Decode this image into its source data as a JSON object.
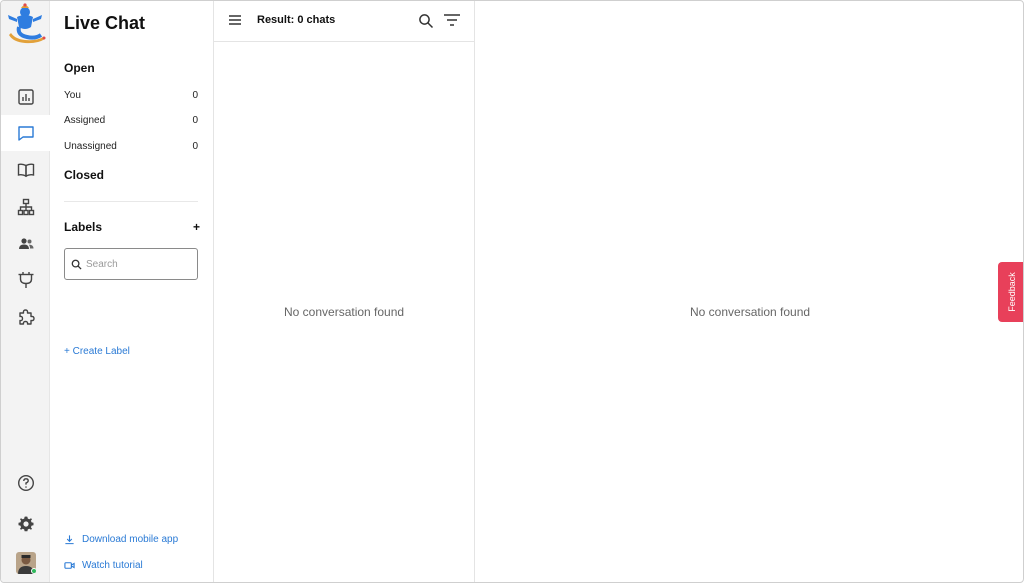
{
  "app": {
    "title": "Live Chat",
    "accent_color": "#2a7ad5",
    "feedback_color": "#e8405a"
  },
  "rail": {
    "items": [
      {
        "icon": "analytics-icon",
        "active": false
      },
      {
        "icon": "chat-bubble-icon",
        "active": true
      },
      {
        "icon": "book-icon",
        "active": false
      },
      {
        "icon": "sitemap-icon",
        "active": false
      },
      {
        "icon": "contacts-icon",
        "active": false
      },
      {
        "icon": "plug-icon",
        "active": false
      },
      {
        "icon": "puzzle-icon",
        "active": false
      }
    ],
    "bottom": [
      {
        "icon": "help-circle-icon"
      },
      {
        "icon": "gear-icon"
      }
    ]
  },
  "sidebar": {
    "open_heading": "Open",
    "open_items": [
      {
        "label": "You",
        "count": "0"
      },
      {
        "label": "Assigned",
        "count": "0"
      },
      {
        "label": "Unassigned",
        "count": "0"
      }
    ],
    "closed_heading": "Closed",
    "labels_heading": "Labels",
    "search_placeholder": "Search",
    "create_label": "+ Create Label",
    "download_app": "Download mobile app",
    "watch_tutorial": "Watch tutorial"
  },
  "chatlist": {
    "result_text": "Result: 0 chats",
    "empty_message": "No conversation found"
  },
  "conversation": {
    "empty_message": "No conversation found"
  },
  "feedback": {
    "label": "Feedback"
  }
}
